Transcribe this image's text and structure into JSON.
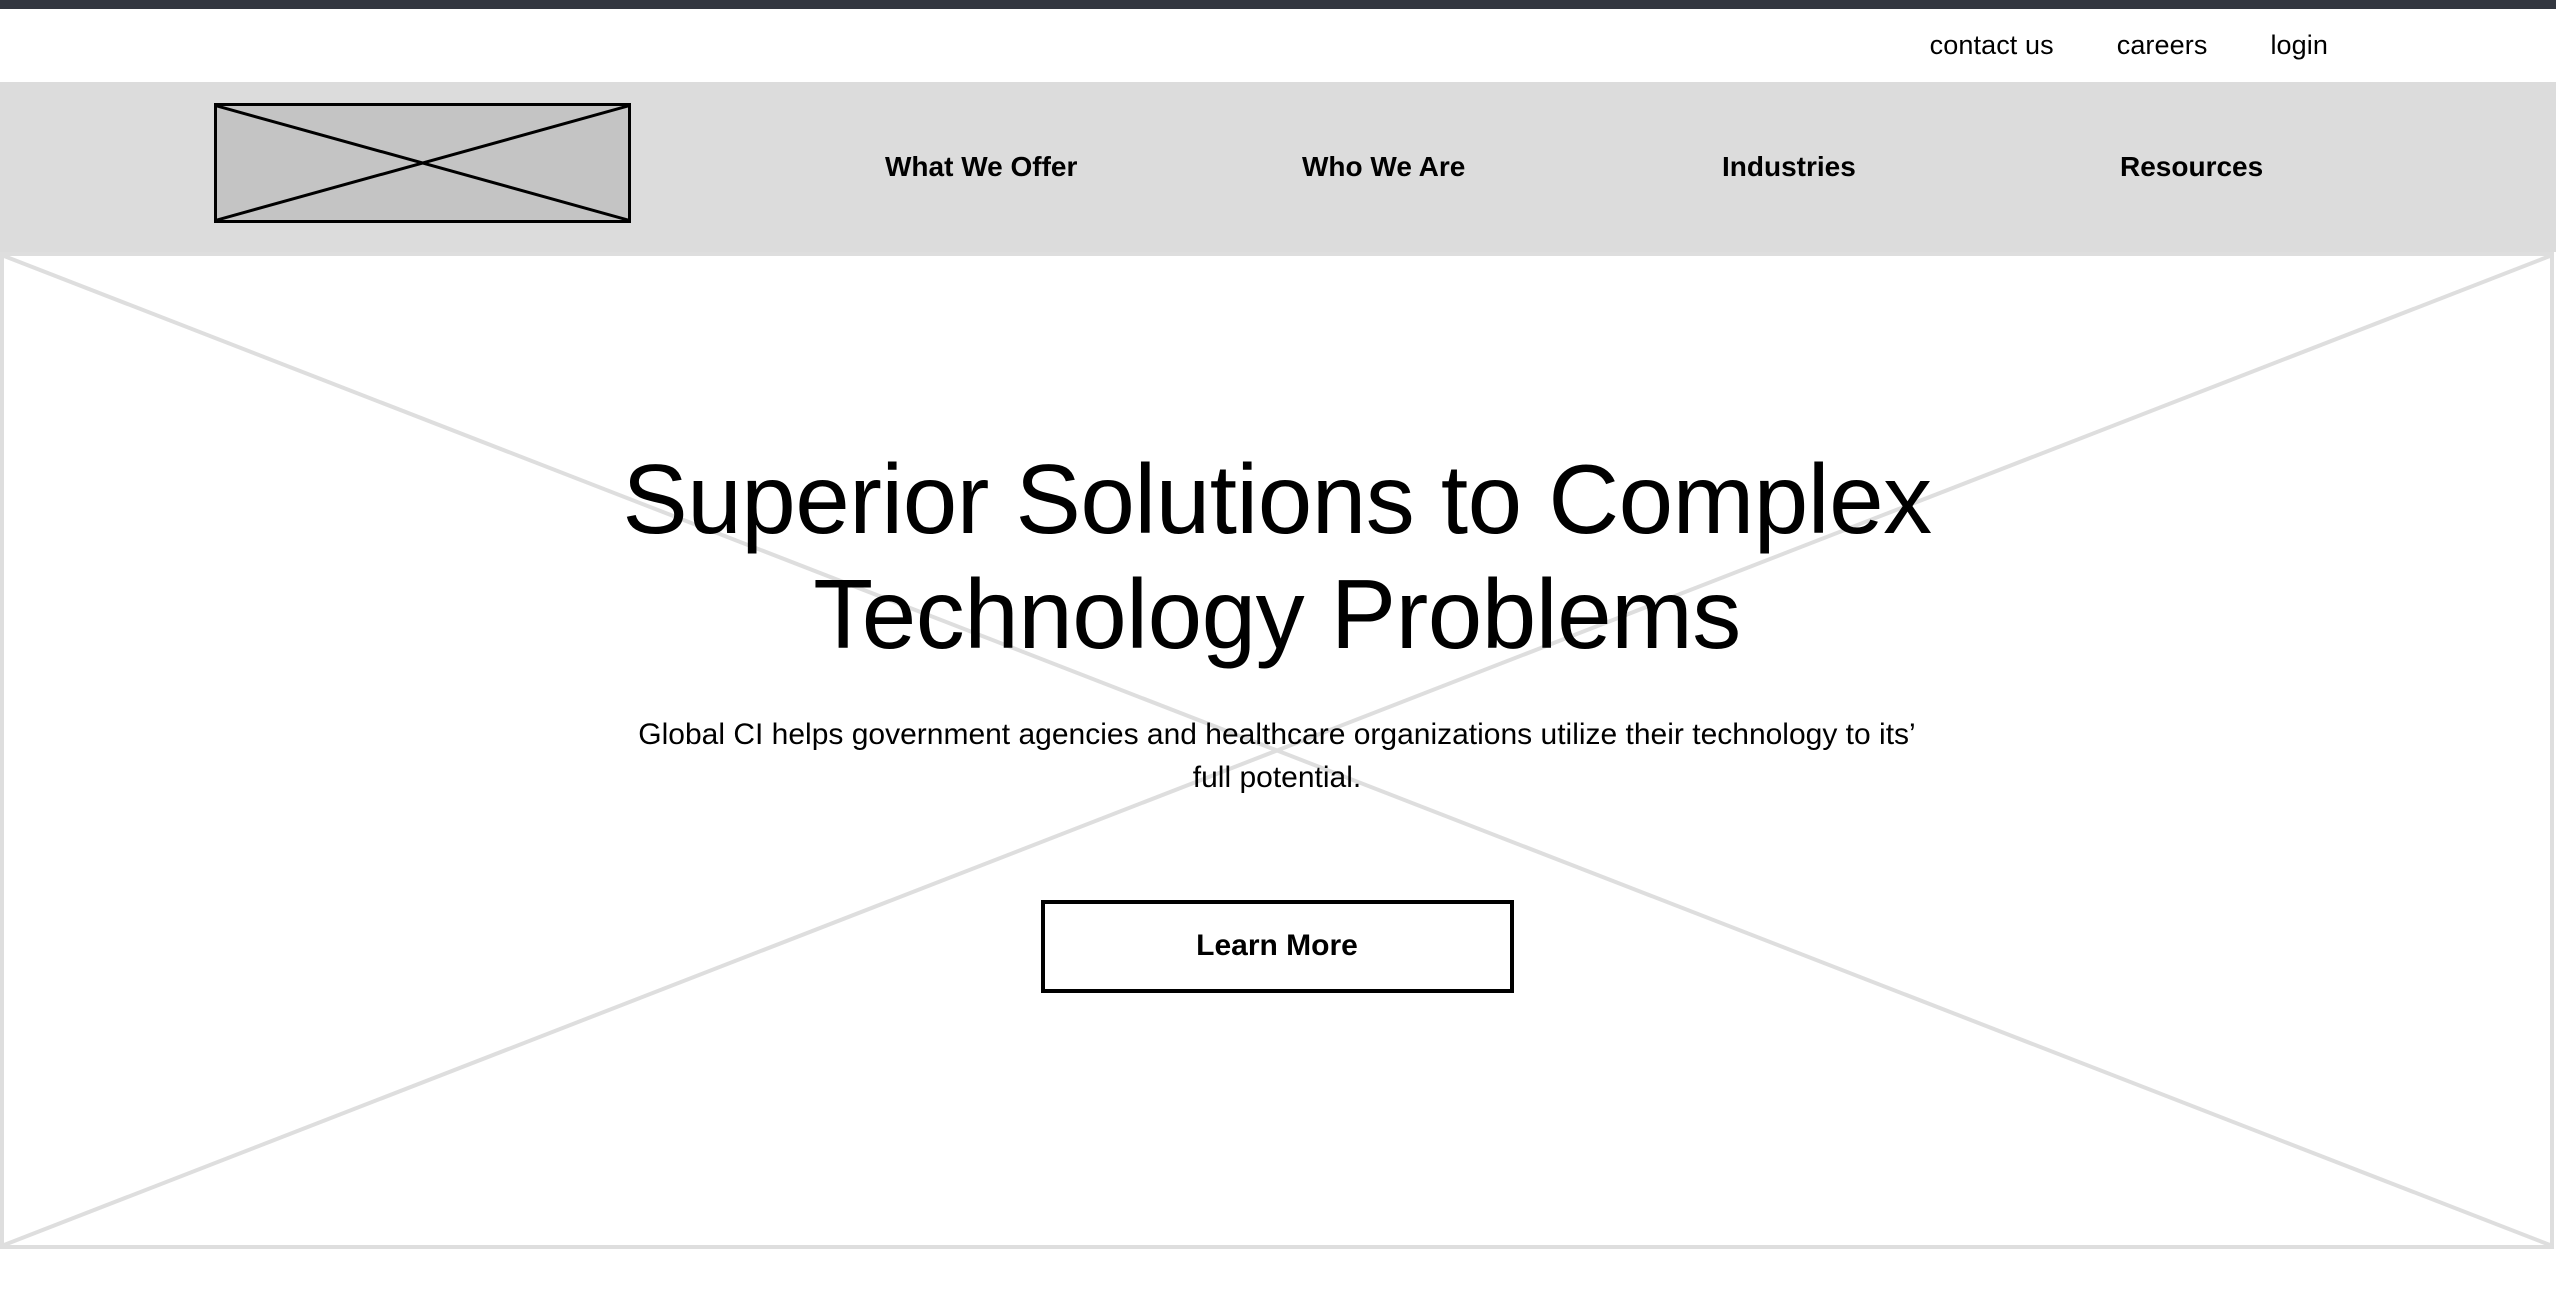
{
  "theme": {
    "top_strip_color": "#333740",
    "navbar_bg": "#dcdcdc",
    "placeholder_fill": "#c4c4c4",
    "hero_border_color": "#dedede",
    "text_color": "#000000",
    "page_bg": "#ffffff"
  },
  "utility_nav": {
    "items": [
      {
        "label": "contact us"
      },
      {
        "label": "careers"
      },
      {
        "label": "login"
      }
    ]
  },
  "brand": {
    "logo_icon": "image-placeholder-icon",
    "logo_alt": ""
  },
  "main_nav": {
    "items": [
      {
        "label": "What We Offer"
      },
      {
        "label": "Who We Are"
      },
      {
        "label": "Industries"
      },
      {
        "label": "Resources"
      }
    ]
  },
  "hero": {
    "background_icon": "image-placeholder-icon",
    "title": "Superior Solutions to Complex Technology Problems",
    "subtitle": "Global CI helps government agencies and healthcare organizations utilize their technology to its’ full potential.",
    "cta_label": "Learn More"
  }
}
